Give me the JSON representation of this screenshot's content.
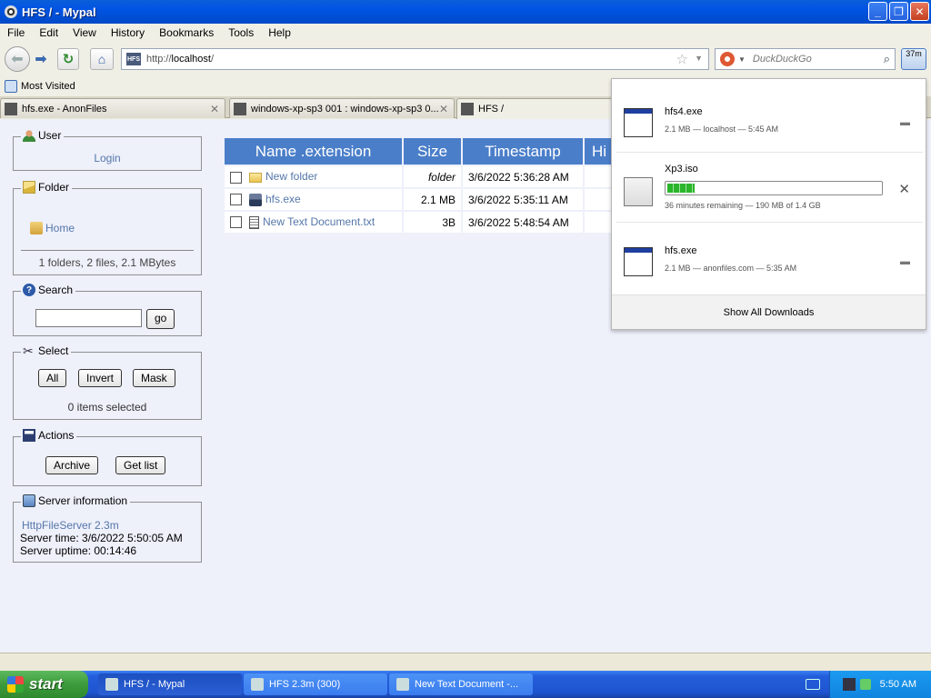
{
  "window": {
    "title": "HFS / - Mypal",
    "controls": {
      "minimize": "_",
      "maximize": "❐",
      "close": "✕"
    }
  },
  "menu": [
    "File",
    "Edit",
    "View",
    "History",
    "Bookmarks",
    "Tools",
    "Help"
  ],
  "nav": {
    "url_prefix": "http://",
    "url_host": "localhost",
    "url_suffix": "/",
    "search_placeholder": "DuckDuckGo",
    "downloads_time": "37m"
  },
  "bookmarks": {
    "most_visited": "Most Visited"
  },
  "tabs": [
    {
      "label": "hfs.exe - AnonFiles",
      "close": "✕"
    },
    {
      "label": "windows-xp-sp3 001 : windows-xp-sp3 0...",
      "close": "✕"
    },
    {
      "label": "HFS /",
      "close": ""
    }
  ],
  "sidebar": {
    "user": {
      "title": "User",
      "login": "Login"
    },
    "folder": {
      "title": "Folder",
      "home": "Home",
      "summary": "1 folders, 2 files, 2.1 MBytes"
    },
    "search": {
      "title": "Search",
      "go": "go",
      "value": ""
    },
    "select": {
      "title": "Select",
      "all": "All",
      "invert": "Invert",
      "mask": "Mask",
      "summary": "0 items selected"
    },
    "actions": {
      "title": "Actions",
      "archive": "Archive",
      "get_list": "Get list"
    },
    "server": {
      "title": "Server information",
      "version": "HttpFileServer 2.3m",
      "time": "Server time: 3/6/2022 5:50:05 AM",
      "uptime": "Server uptime: 00:14:46"
    }
  },
  "files": {
    "headers": [
      "Name .extension",
      "Size",
      "Timestamp",
      "Hi"
    ],
    "rows": [
      {
        "name": "New folder",
        "size": "folder",
        "timestamp": "3/6/2022 5:36:28 AM",
        "icon": "folder-icon"
      },
      {
        "name": "hfs.exe",
        "size": "2.1 MB",
        "timestamp": "3/6/2022 5:35:11 AM",
        "icon": "hfs-exe-icon"
      },
      {
        "name": "New Text Document.txt",
        "size": "3B",
        "timestamp": "3/6/2022 5:48:54 AM",
        "icon": "text-document-icon"
      }
    ]
  },
  "downloads": {
    "items": [
      {
        "name": "hfs4.exe",
        "status": "2.1 MB — localhost — 5:45 AM",
        "action": "folder"
      },
      {
        "name": "Xp3.iso",
        "status": "36 minutes remaining — 190 MB of 1.4 GB",
        "action": "cancel",
        "progress": 0.13
      },
      {
        "name": "hfs.exe",
        "status": "2.1 MB — anonfiles.com — 5:35 AM",
        "action": "folder"
      }
    ],
    "show_all": "Show All Downloads"
  },
  "taskbar": {
    "start": "start",
    "tasks": [
      "HFS / - Mypal",
      "HFS 2.3m (300)",
      "New Text Document -..."
    ],
    "clock": "5:50 AM"
  },
  "colors": {
    "header_blue": "#4a7ec9",
    "link": "#5577aa",
    "page_bg": "#eef0fa",
    "progress_green": "#2bb52b"
  }
}
